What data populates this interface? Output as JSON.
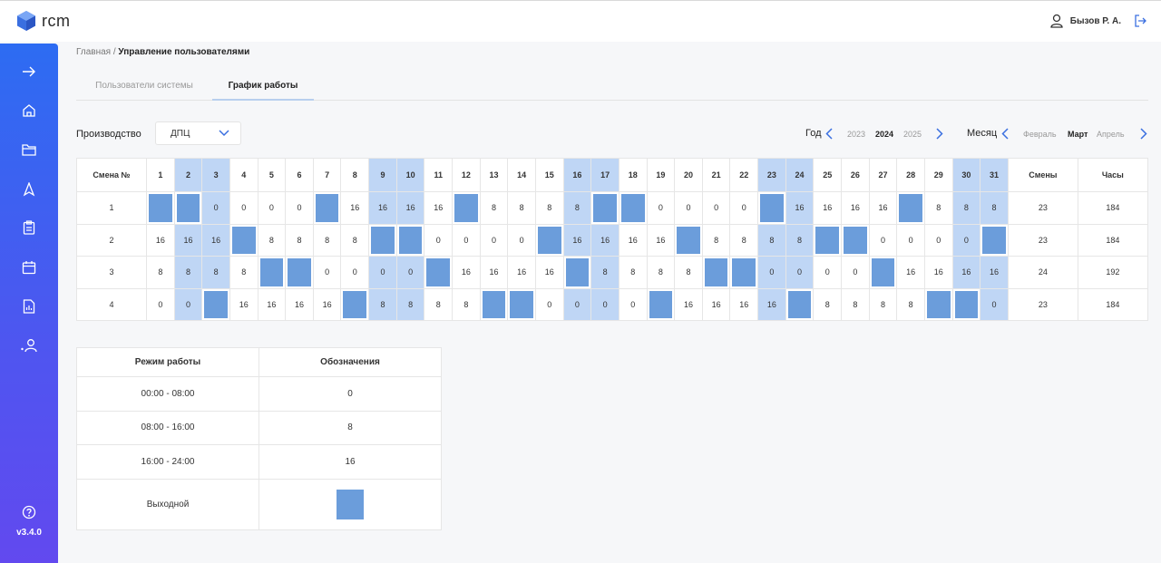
{
  "app": {
    "logo_text": "rcm",
    "version": "v3.4.0"
  },
  "user": {
    "name": "Бызов Р. А."
  },
  "breadcrumb": {
    "home": "Главная",
    "separator": " / ",
    "current": "Управление пользователями"
  },
  "tabs": [
    {
      "label": "Пользователи системы",
      "active": false
    },
    {
      "label": "График работы",
      "active": true
    }
  ],
  "filters": {
    "production_label": "Производство",
    "production_value": "ДПЦ",
    "year_label": "Год",
    "years": [
      "2023",
      "2024",
      "2025"
    ],
    "year_selected": "2024",
    "month_label": "Месяц",
    "months": [
      "Февраль",
      "Март",
      "Апрель"
    ],
    "month_selected": "Март"
  },
  "schedule": {
    "header_shift": "Смена №",
    "header_shifts": "Смены",
    "header_hours": "Часы",
    "days": [
      1,
      2,
      3,
      4,
      5,
      6,
      7,
      8,
      9,
      10,
      11,
      12,
      13,
      14,
      15,
      16,
      17,
      18,
      19,
      20,
      21,
      22,
      23,
      24,
      25,
      26,
      27,
      28,
      29,
      30,
      31
    ],
    "weekend_days": [
      2,
      3,
      9,
      10,
      16,
      17,
      23,
      24,
      30,
      31
    ],
    "rows": [
      {
        "shift": "1",
        "cells": [
          "X",
          "X",
          "0",
          "0",
          "0",
          "0",
          "X",
          "16",
          "16",
          "16",
          "16",
          "X",
          "8",
          "8",
          "8",
          "8",
          "X",
          "X",
          "0",
          "0",
          "0",
          "0",
          "X",
          "16",
          "16",
          "16",
          "16",
          "X",
          "8",
          "8",
          "8"
        ],
        "shifts": "23",
        "hours": "184"
      },
      {
        "shift": "2",
        "cells": [
          "16",
          "16",
          "16",
          "X",
          "8",
          "8",
          "8",
          "8",
          "X",
          "X",
          "0",
          "0",
          "0",
          "0",
          "X",
          "16",
          "16",
          "16",
          "16",
          "X",
          "8",
          "8",
          "8",
          "8",
          "X",
          "X",
          "0",
          "0",
          "0",
          "0",
          "X"
        ],
        "shifts": "23",
        "hours": "184"
      },
      {
        "shift": "3",
        "cells": [
          "8",
          "8",
          "8",
          "8",
          "X",
          "X",
          "0",
          "0",
          "0",
          "0",
          "X",
          "16",
          "16",
          "16",
          "16",
          "X",
          "8",
          "8",
          "8",
          "8",
          "X",
          "X",
          "0",
          "0",
          "0",
          "0",
          "X",
          "16",
          "16",
          "16",
          "16"
        ],
        "shifts": "24",
        "hours": "192"
      },
      {
        "shift": "4",
        "cells": [
          "0",
          "0",
          "X",
          "16",
          "16",
          "16",
          "16",
          "X",
          "8",
          "8",
          "8",
          "8",
          "X",
          "X",
          "0",
          "0",
          "0",
          "0",
          "X",
          "16",
          "16",
          "16",
          "16",
          "X",
          "8",
          "8",
          "8",
          "8",
          "X",
          "X",
          "0"
        ],
        "shifts": "23",
        "hours": "184"
      }
    ]
  },
  "legend": {
    "header_mode": "Режим работы",
    "header_symbol": "Обозначения",
    "rows": [
      {
        "mode": "00:00 - 08:00",
        "symbol": "0"
      },
      {
        "mode": "08:00 - 16:00",
        "symbol": "8"
      },
      {
        "mode": "16:00 - 24:00",
        "symbol": "16"
      }
    ],
    "off_label": "Выходной"
  },
  "icons": [
    "logo-cube-icon",
    "user-icon",
    "logout-icon",
    "expand-arrow-icon",
    "home-icon",
    "folder-icon",
    "rocket-icon",
    "clipboard-icon",
    "calendar-icon",
    "report-icon",
    "users-icon",
    "help-icon",
    "chevron-down-icon",
    "chevron-left-icon",
    "chevron-right-icon"
  ],
  "colors": {
    "accent": "#2d6cf2",
    "weekend_header": "#bfd6f5",
    "day_off": "#6b9ddb"
  }
}
